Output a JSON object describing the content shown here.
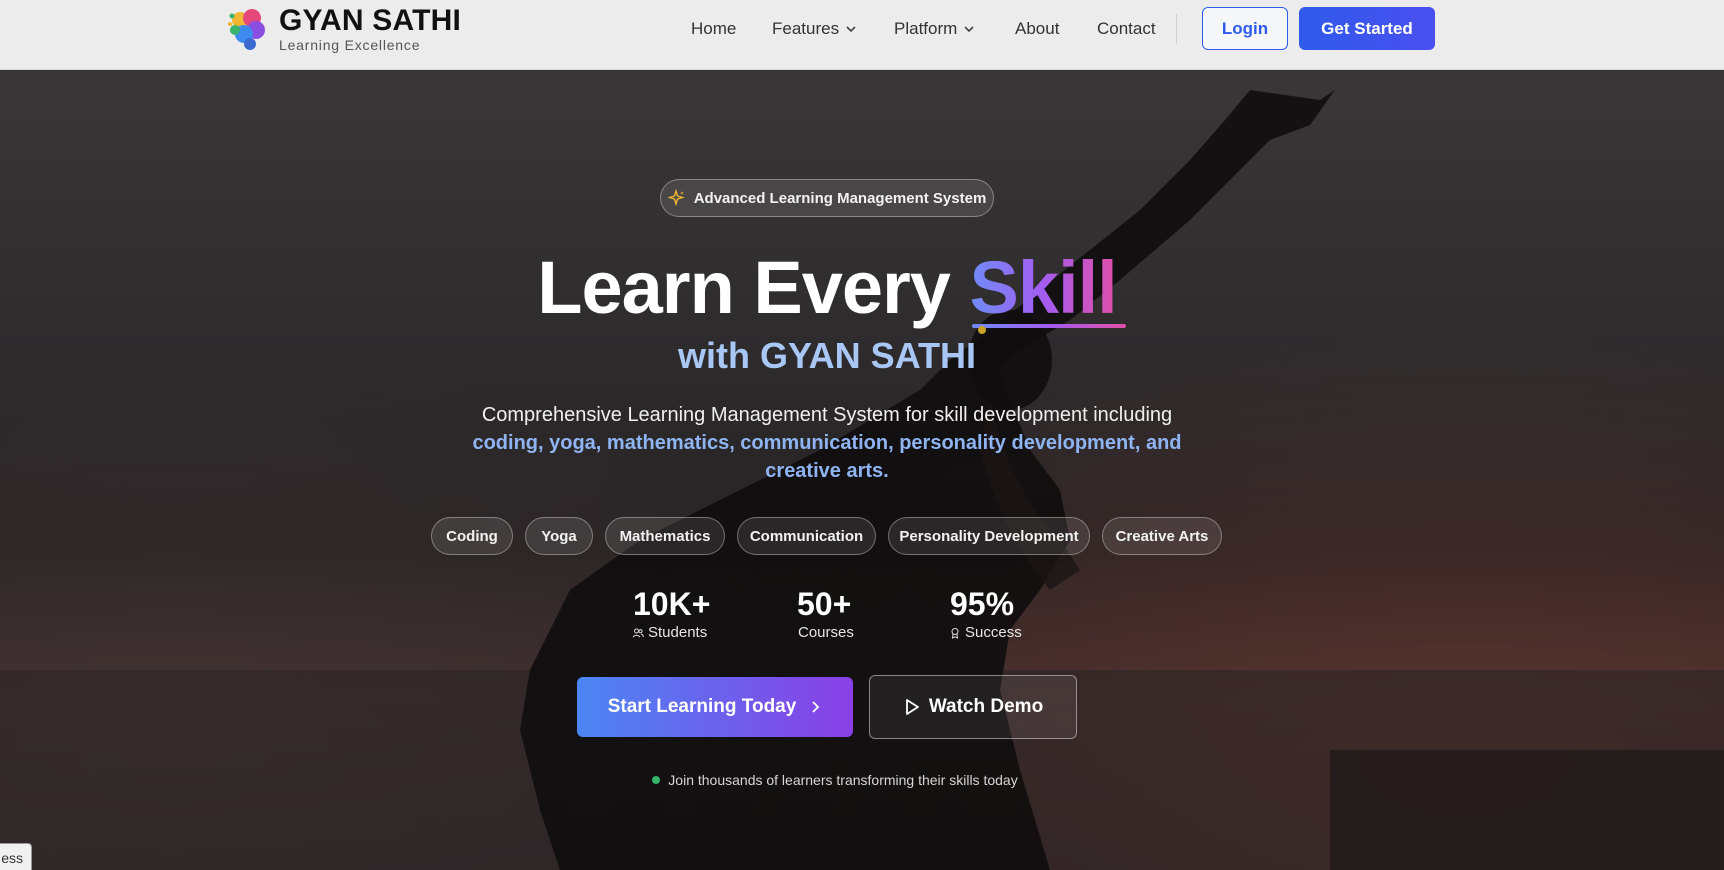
{
  "nav": {
    "brand_name": "GYAN SATHI",
    "brand_tagline": "Learning Excellence",
    "links": {
      "home": "Home",
      "features": "Features",
      "platform": "Platform",
      "about": "About",
      "contact": "Contact"
    },
    "login_label": "Login",
    "get_started_label": "Get Started"
  },
  "hero": {
    "badge": "Advanced Learning Management System",
    "headline_prefix": "Learn Every",
    "headline_highlight": "Skill",
    "subheadline": "with GYAN SATHI",
    "description_plain": "Comprehensive Learning Management System for skill development including",
    "description_highlight": "coding, yoga, mathematics, communication, personality development, and creative arts.",
    "pills": [
      "Coding",
      "Yoga",
      "Mathematics",
      "Communication",
      "Personality Development",
      "Creative Arts"
    ],
    "stats": [
      {
        "value": "10K+",
        "label": "Students",
        "icon": "users-icon"
      },
      {
        "value": "50+",
        "label": "Courses",
        "icon": ""
      },
      {
        "value": "95%",
        "label": "Success",
        "icon": "award-icon"
      }
    ],
    "primary_cta": "Start Learning Today",
    "secondary_cta": "Watch Demo",
    "join_text": "Join thousands of learners transforming their skills today"
  },
  "corner_tab_text": "ess",
  "colors": {
    "accent_blue": "#2f5bea",
    "gradient_start": "#6f8cf7",
    "gradient_mid": "#a35cf0",
    "gradient_end": "#e14fa8",
    "subheadline": "#a9c7f5",
    "status_green": "#35b36b"
  }
}
